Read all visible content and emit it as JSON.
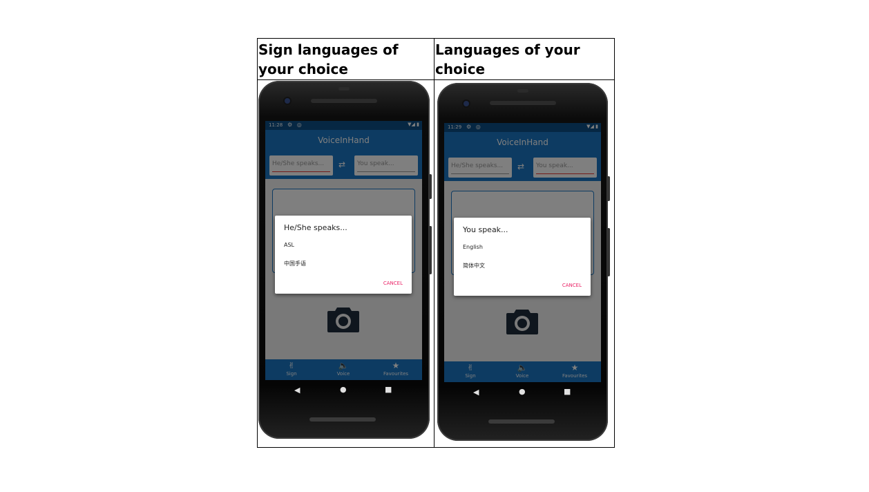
{
  "table": {
    "headers": [
      "Sign languages of your choice",
      "Languages of your choice"
    ]
  },
  "screens": [
    {
      "status_time": "11:28",
      "status_icons": "⚙ ◎",
      "status_right": "▼◢ ▮",
      "app_title": "VoiceInHand",
      "left_input_placeholder": "He/She speaks...",
      "right_input_placeholder": "You speak...",
      "swap_icon": "swap-arrows-icon",
      "dialog": {
        "title": "He/She speaks...",
        "options": [
          "ASL",
          "中国手语"
        ],
        "cancel_label": "CANCEL"
      },
      "nav": [
        {
          "icon": "sign-hands-icon",
          "label": "Sign"
        },
        {
          "icon": "speaker-icon",
          "label": "Voice"
        },
        {
          "icon": "star-icon",
          "label": "Favourites"
        }
      ]
    },
    {
      "status_time": "11:29",
      "status_icons": "⚙ ◎",
      "status_right": "▼◢ ▮",
      "app_title": "VoiceInHand",
      "left_input_placeholder": "He/She speaks...",
      "right_input_placeholder": "You speak...",
      "swap_icon": "swap-arrows-icon",
      "dialog": {
        "title": "You speak...",
        "options": [
          "English",
          "简体中文"
        ],
        "cancel_label": "CANCEL"
      },
      "nav": [
        {
          "icon": "sign-hands-icon",
          "label": "Sign"
        },
        {
          "icon": "speaker-icon",
          "label": "Voice"
        },
        {
          "icon": "star-icon",
          "label": "Favourites"
        }
      ]
    }
  ],
  "colors": {
    "app_primary": "#1a76c4",
    "status_bar": "#0d4f86",
    "accent": "#e91e63",
    "input_underline_active": "#e53935"
  }
}
